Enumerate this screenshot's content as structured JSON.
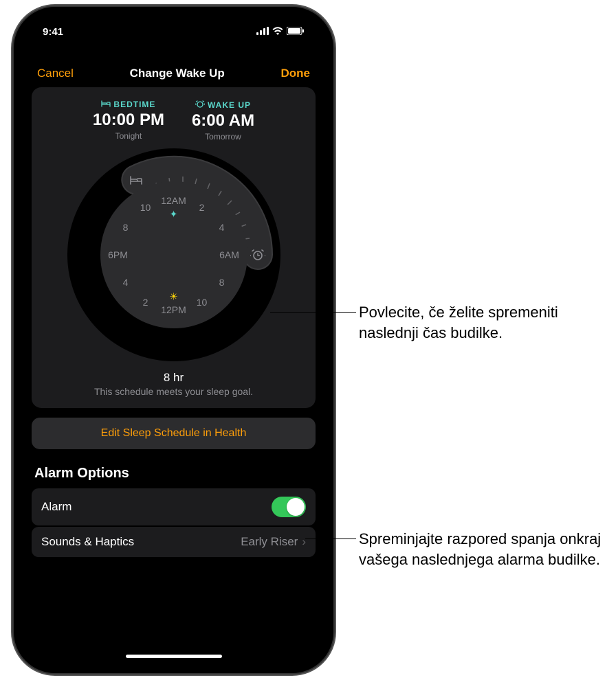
{
  "status": {
    "time": "9:41"
  },
  "nav": {
    "cancel": "Cancel",
    "title": "Change Wake Up",
    "done": "Done"
  },
  "schedule": {
    "bedtime": {
      "label": "BEDTIME",
      "time": "10:00 PM",
      "sub": "Tonight"
    },
    "wakeup": {
      "label": "WAKE UP",
      "time": "6:00 AM",
      "sub": "Tomorrow"
    }
  },
  "clock_ticks": {
    "top": "12AM",
    "right": "6AM",
    "bottom": "12PM",
    "left": "6PM",
    "n2a": "2",
    "n4a": "4",
    "n8a": "8",
    "n10a": "10",
    "n2p": "2",
    "n4p": "4",
    "n8p": "8",
    "n10p": "10"
  },
  "duration": {
    "value": "8 hr",
    "msg": "This schedule meets your sleep goal."
  },
  "edit_button": "Edit Sleep Schedule in Health",
  "alarm_options": {
    "title": "Alarm Options",
    "alarm_label": "Alarm",
    "sounds_label": "Sounds & Haptics",
    "sounds_value": "Early Riser"
  },
  "callouts": {
    "drag": "Povlecite, če želite spremeniti naslednji čas budilke.",
    "edit": "Spreminjajte razpored spanja onkraj vašega naslednjega alarma budilke."
  },
  "colors": {
    "accent": "#ff9f0a",
    "teal": "#5ad8cc",
    "toggle_on": "#34c759"
  }
}
